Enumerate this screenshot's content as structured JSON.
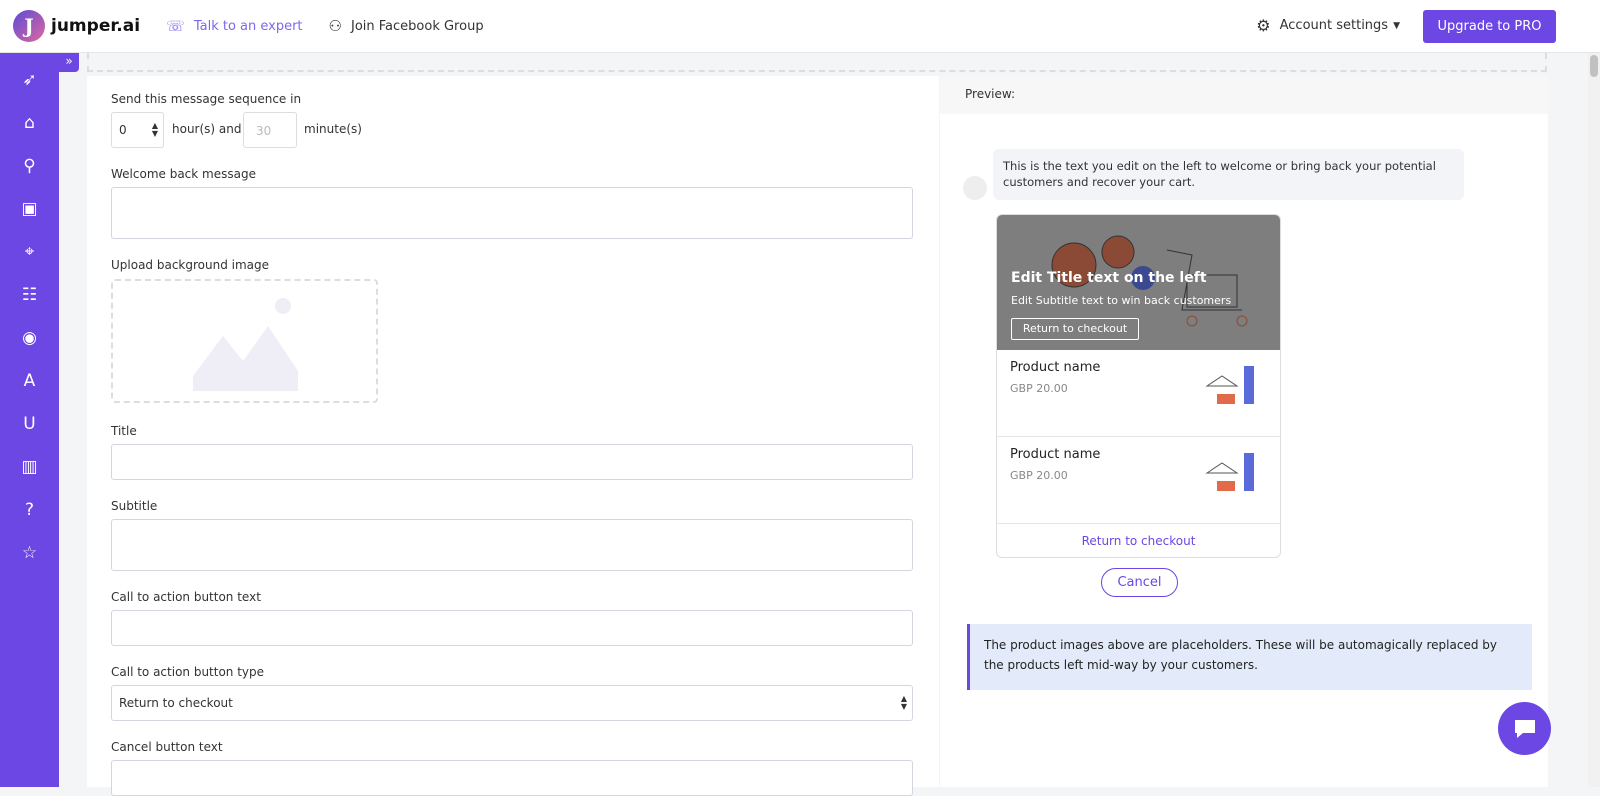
{
  "brand": {
    "name": "jumper.ai",
    "logo_letter": "J"
  },
  "topbar": {
    "talk_expert": "Talk to an expert",
    "join_fb": "Join Facebook Group",
    "account_settings": "Account settings",
    "upgrade": "Upgrade to PRO"
  },
  "sidebar": {
    "expand": "»",
    "items": [
      "rocket",
      "store",
      "plug",
      "box",
      "tag",
      "clipboard",
      "user",
      "translate",
      "magnet",
      "chart",
      "help",
      "star"
    ]
  },
  "form": {
    "send_label": "Send this message sequence in",
    "hours_value": "0",
    "hours_suffix": "hour(s) and",
    "minutes_placeholder": "30",
    "minutes_suffix": "minute(s)",
    "welcome_label": "Welcome back message",
    "upload_label": "Upload background image",
    "title_label": "Title",
    "subtitle_label": "Subtitle",
    "cta_text_label": "Call to action button text",
    "cta_type_label": "Call to action button type",
    "cta_type_value": "Return to checkout",
    "cancel_label": "Cancel button text"
  },
  "preview": {
    "header": "Preview:",
    "bubble": "This is the text you edit on the left to welcome or bring back your potential customers and recover your cart.",
    "hero_title": "Edit Title text on the left",
    "hero_subtitle": "Edit Subtitle text to win back customers",
    "hero_button": "Return to checkout",
    "products": [
      {
        "name": "Product name",
        "price": "GBP 20.00"
      },
      {
        "name": "Product name",
        "price": "GBP 20.00"
      }
    ],
    "footer_link": "Return to checkout",
    "cancel": "Cancel",
    "note": "The product images above are placeholders. These will be automagically replaced by the products left mid-way by your customers."
  },
  "colors": {
    "accent": "#6c47e3"
  }
}
